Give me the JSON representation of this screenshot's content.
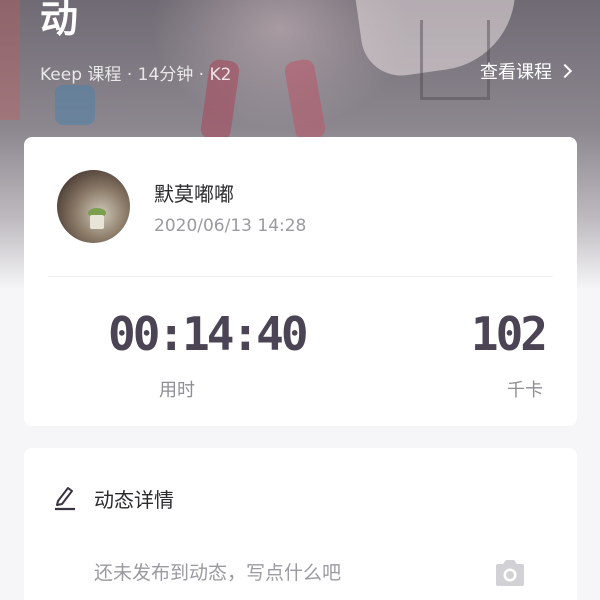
{
  "hero": {
    "title": "动",
    "meta": "Keep 课程 · 14分钟 · K2",
    "link_label": "查看课程"
  },
  "profile": {
    "username": "默莫嘟嘟",
    "datetime": "2020/06/13 14:28"
  },
  "stats": {
    "duration_value": "00:14:40",
    "duration_label": "用时",
    "calories_value": "102",
    "calories_label": "千卡"
  },
  "detail": {
    "title": "动态详情",
    "placeholder": "还未发布到动态，写点什么吧"
  },
  "icons": {
    "link": "chevron-right-icon",
    "detail": "pencil-icon",
    "photo": "camera-icon"
  },
  "colors": {
    "stat_value": "#4b4454",
    "card_bg": "#ffffff",
    "page_bg": "#f6f6f8"
  }
}
